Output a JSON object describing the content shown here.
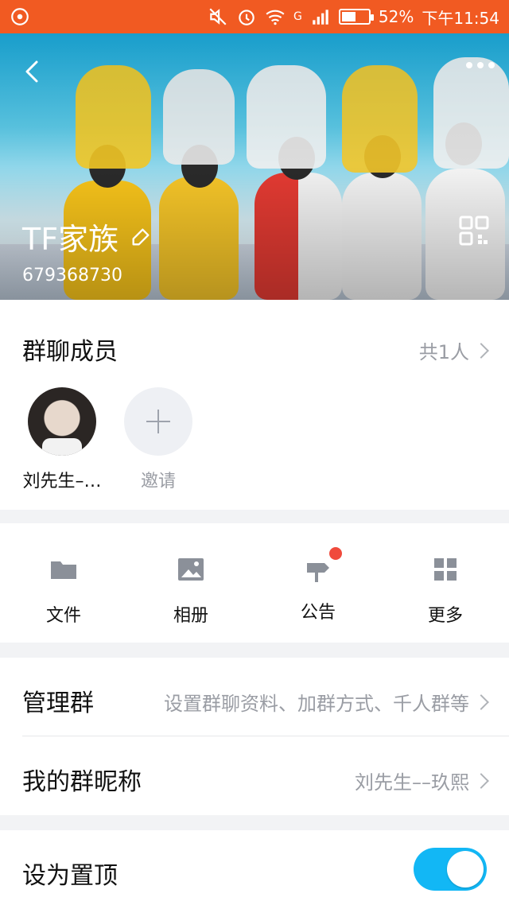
{
  "status_bar": {
    "battery_percent": "52%",
    "time": "下午11:54",
    "network": "G",
    "battery_level": 0.52,
    "icons": [
      "notification-icon",
      "mute-icon",
      "alarm-icon",
      "wifi-icon",
      "signal-icon",
      "battery-icon"
    ]
  },
  "header": {
    "group_name": "TF家族",
    "group_id": "679368730",
    "icons": [
      "back-arrow-icon",
      "more-dots-icon",
      "edit-pencil-icon",
      "qr-code-icon"
    ]
  },
  "members": {
    "title": "群聊成员",
    "count_label": "共1人",
    "list": [
      {
        "name": "刘先生–…"
      }
    ],
    "invite_label": "邀请"
  },
  "tools": [
    {
      "label": "文件",
      "icon": "folder-icon"
    },
    {
      "label": "相册",
      "icon": "photo-icon"
    },
    {
      "label": "公告",
      "icon": "announcement-icon"
    },
    {
      "label": "更多",
      "icon": "grid-icon"
    }
  ],
  "manage": {
    "title": "管理群",
    "subtitle": "设置群聊资料、加群方式、千人群等",
    "nickname_title": "我的群昵称",
    "nickname_value": "刘先生––玖熙"
  },
  "pin": {
    "title": "设为置顶",
    "enabled": true
  },
  "colors": {
    "status_bar": "#f15a22",
    "toggle_on": "#12b7f5",
    "badge": "#f04a3c"
  }
}
